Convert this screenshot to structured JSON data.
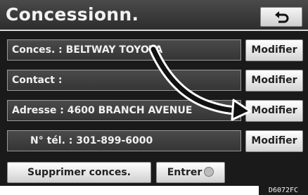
{
  "header": {
    "title": "Concessionn.",
    "back_icon": "return-arrow-icon"
  },
  "rows": [
    {
      "label": "Conces. : BELTWAY TOYOTA",
      "button": "Modifier"
    },
    {
      "label": "Contact :",
      "button": "Modifier"
    },
    {
      "label": "Adresse : 4600 BRANCH AVENUE",
      "button": "Modifier"
    },
    {
      "label": "N° tél. : 301-899-6000",
      "button": "Modifier"
    }
  ],
  "footer": {
    "delete_label": "Supprimer conces.",
    "enter_label": "Entrer",
    "enter_icon": "enter-circle-icon"
  },
  "figure_code": "D6072FC"
}
